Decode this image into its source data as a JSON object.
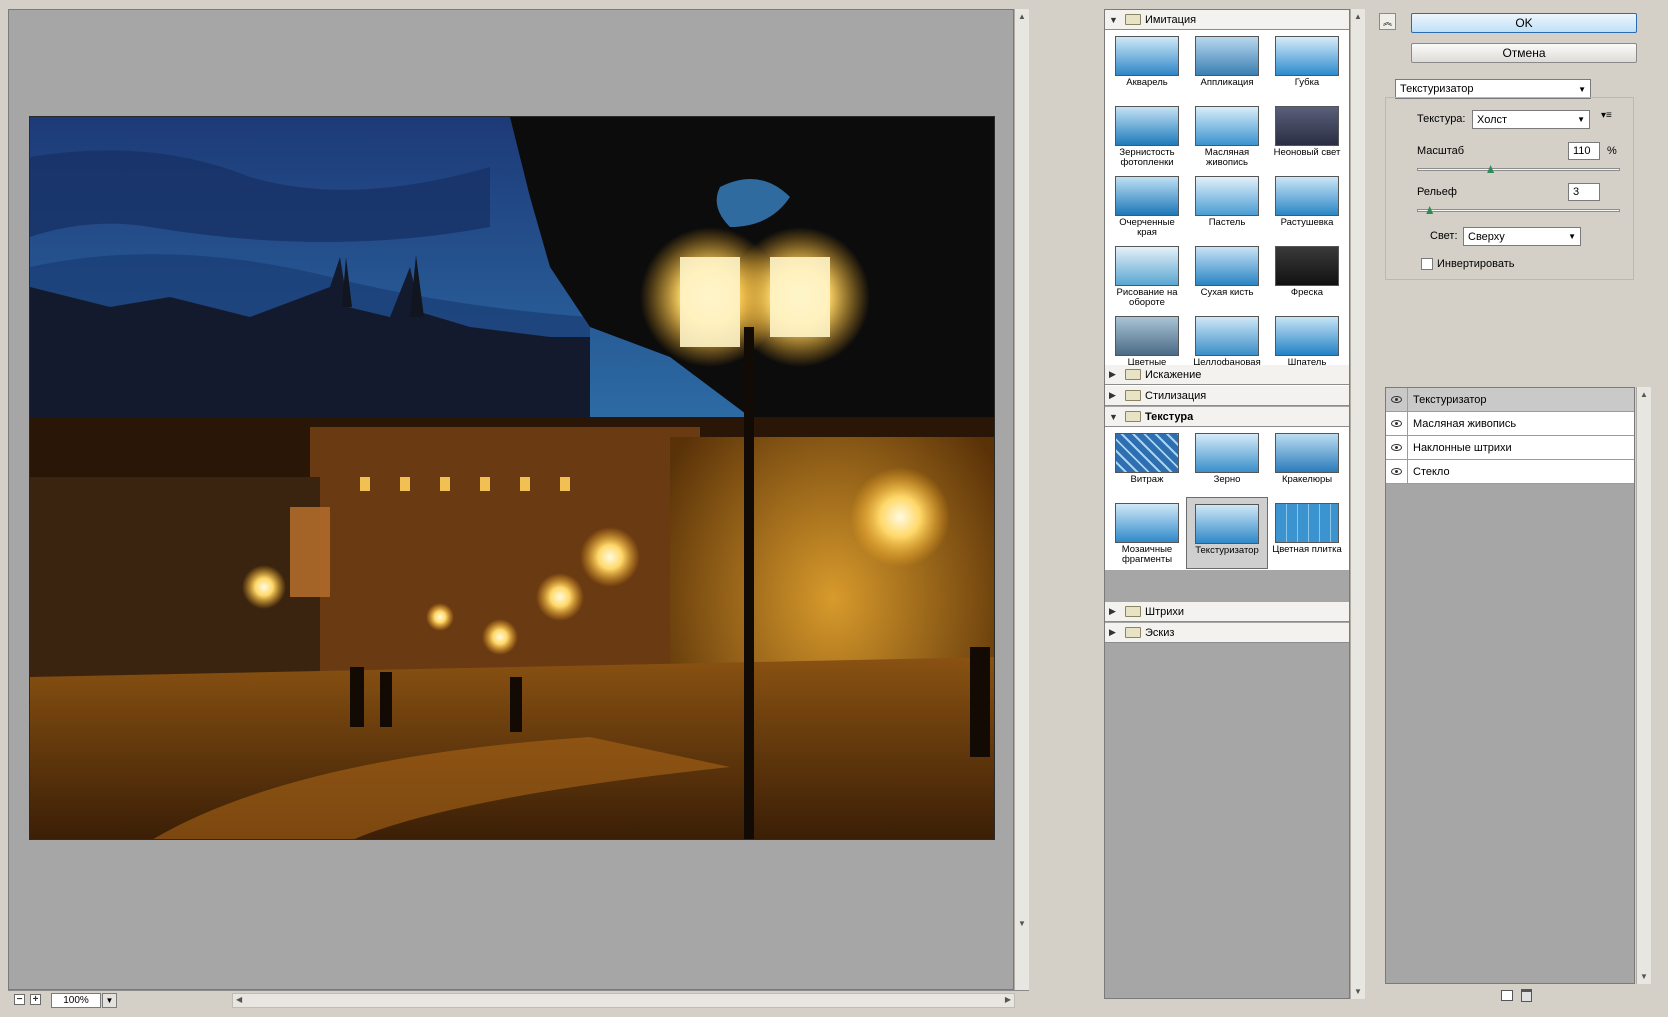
{
  "preview": {
    "zoom": "100%"
  },
  "gallery": {
    "categories": [
      {
        "name": "Имитация",
        "expanded": true,
        "filters": [
          "Акварель",
          "Аппликация",
          "Губка",
          "Зернистость фотопленки",
          "Масляная живопись",
          "Неоновый свет",
          "Очерченные края",
          "Пастель",
          "Растушевка",
          "Рисование на обороте",
          "Сухая кисть",
          "Фреска",
          "Цветные карандаши",
          "Целлофановая упаковка",
          "Шпатель"
        ]
      },
      {
        "name": "Искажение",
        "expanded": false
      },
      {
        "name": "Стилизация",
        "expanded": false
      },
      {
        "name": "Текстура",
        "expanded": true,
        "filters": [
          "Витраж",
          "Зерно",
          "Кракелюры",
          "Мозаичные фрагменты",
          "Текстуризатор",
          "Цветная плитка"
        ],
        "selected": "Текстуризатор"
      },
      {
        "name": "Штрихи",
        "expanded": false
      },
      {
        "name": "Эскиз",
        "expanded": false
      }
    ]
  },
  "actions": {
    "ok_label": "OK",
    "cancel_label": "Отмена"
  },
  "filter_select": {
    "value": "Текстуризатор"
  },
  "settings": {
    "texture_label": "Текстура:",
    "texture_value": "Холст",
    "scale_label": "Масштаб",
    "scale_value": "110",
    "scale_unit": "%",
    "scale_fraction": 0.36,
    "relief_label": "Рельеф",
    "relief_value": "3",
    "relief_fraction": 0.06,
    "light_label": "Свет:",
    "light_value": "Сверху",
    "invert_label": "Инвертировать",
    "invert_checked": false
  },
  "layers": [
    {
      "name": "Текстуризатор",
      "selected": true
    },
    {
      "name": "Масляная живопись",
      "selected": false
    },
    {
      "name": "Наклонные штрихи",
      "selected": false
    },
    {
      "name": "Стекло",
      "selected": false
    }
  ],
  "colors": {
    "panel_bg": "#d4d0c8",
    "gallery_bg": "#a6a6a6",
    "ok_border": "#2a6cb2"
  }
}
